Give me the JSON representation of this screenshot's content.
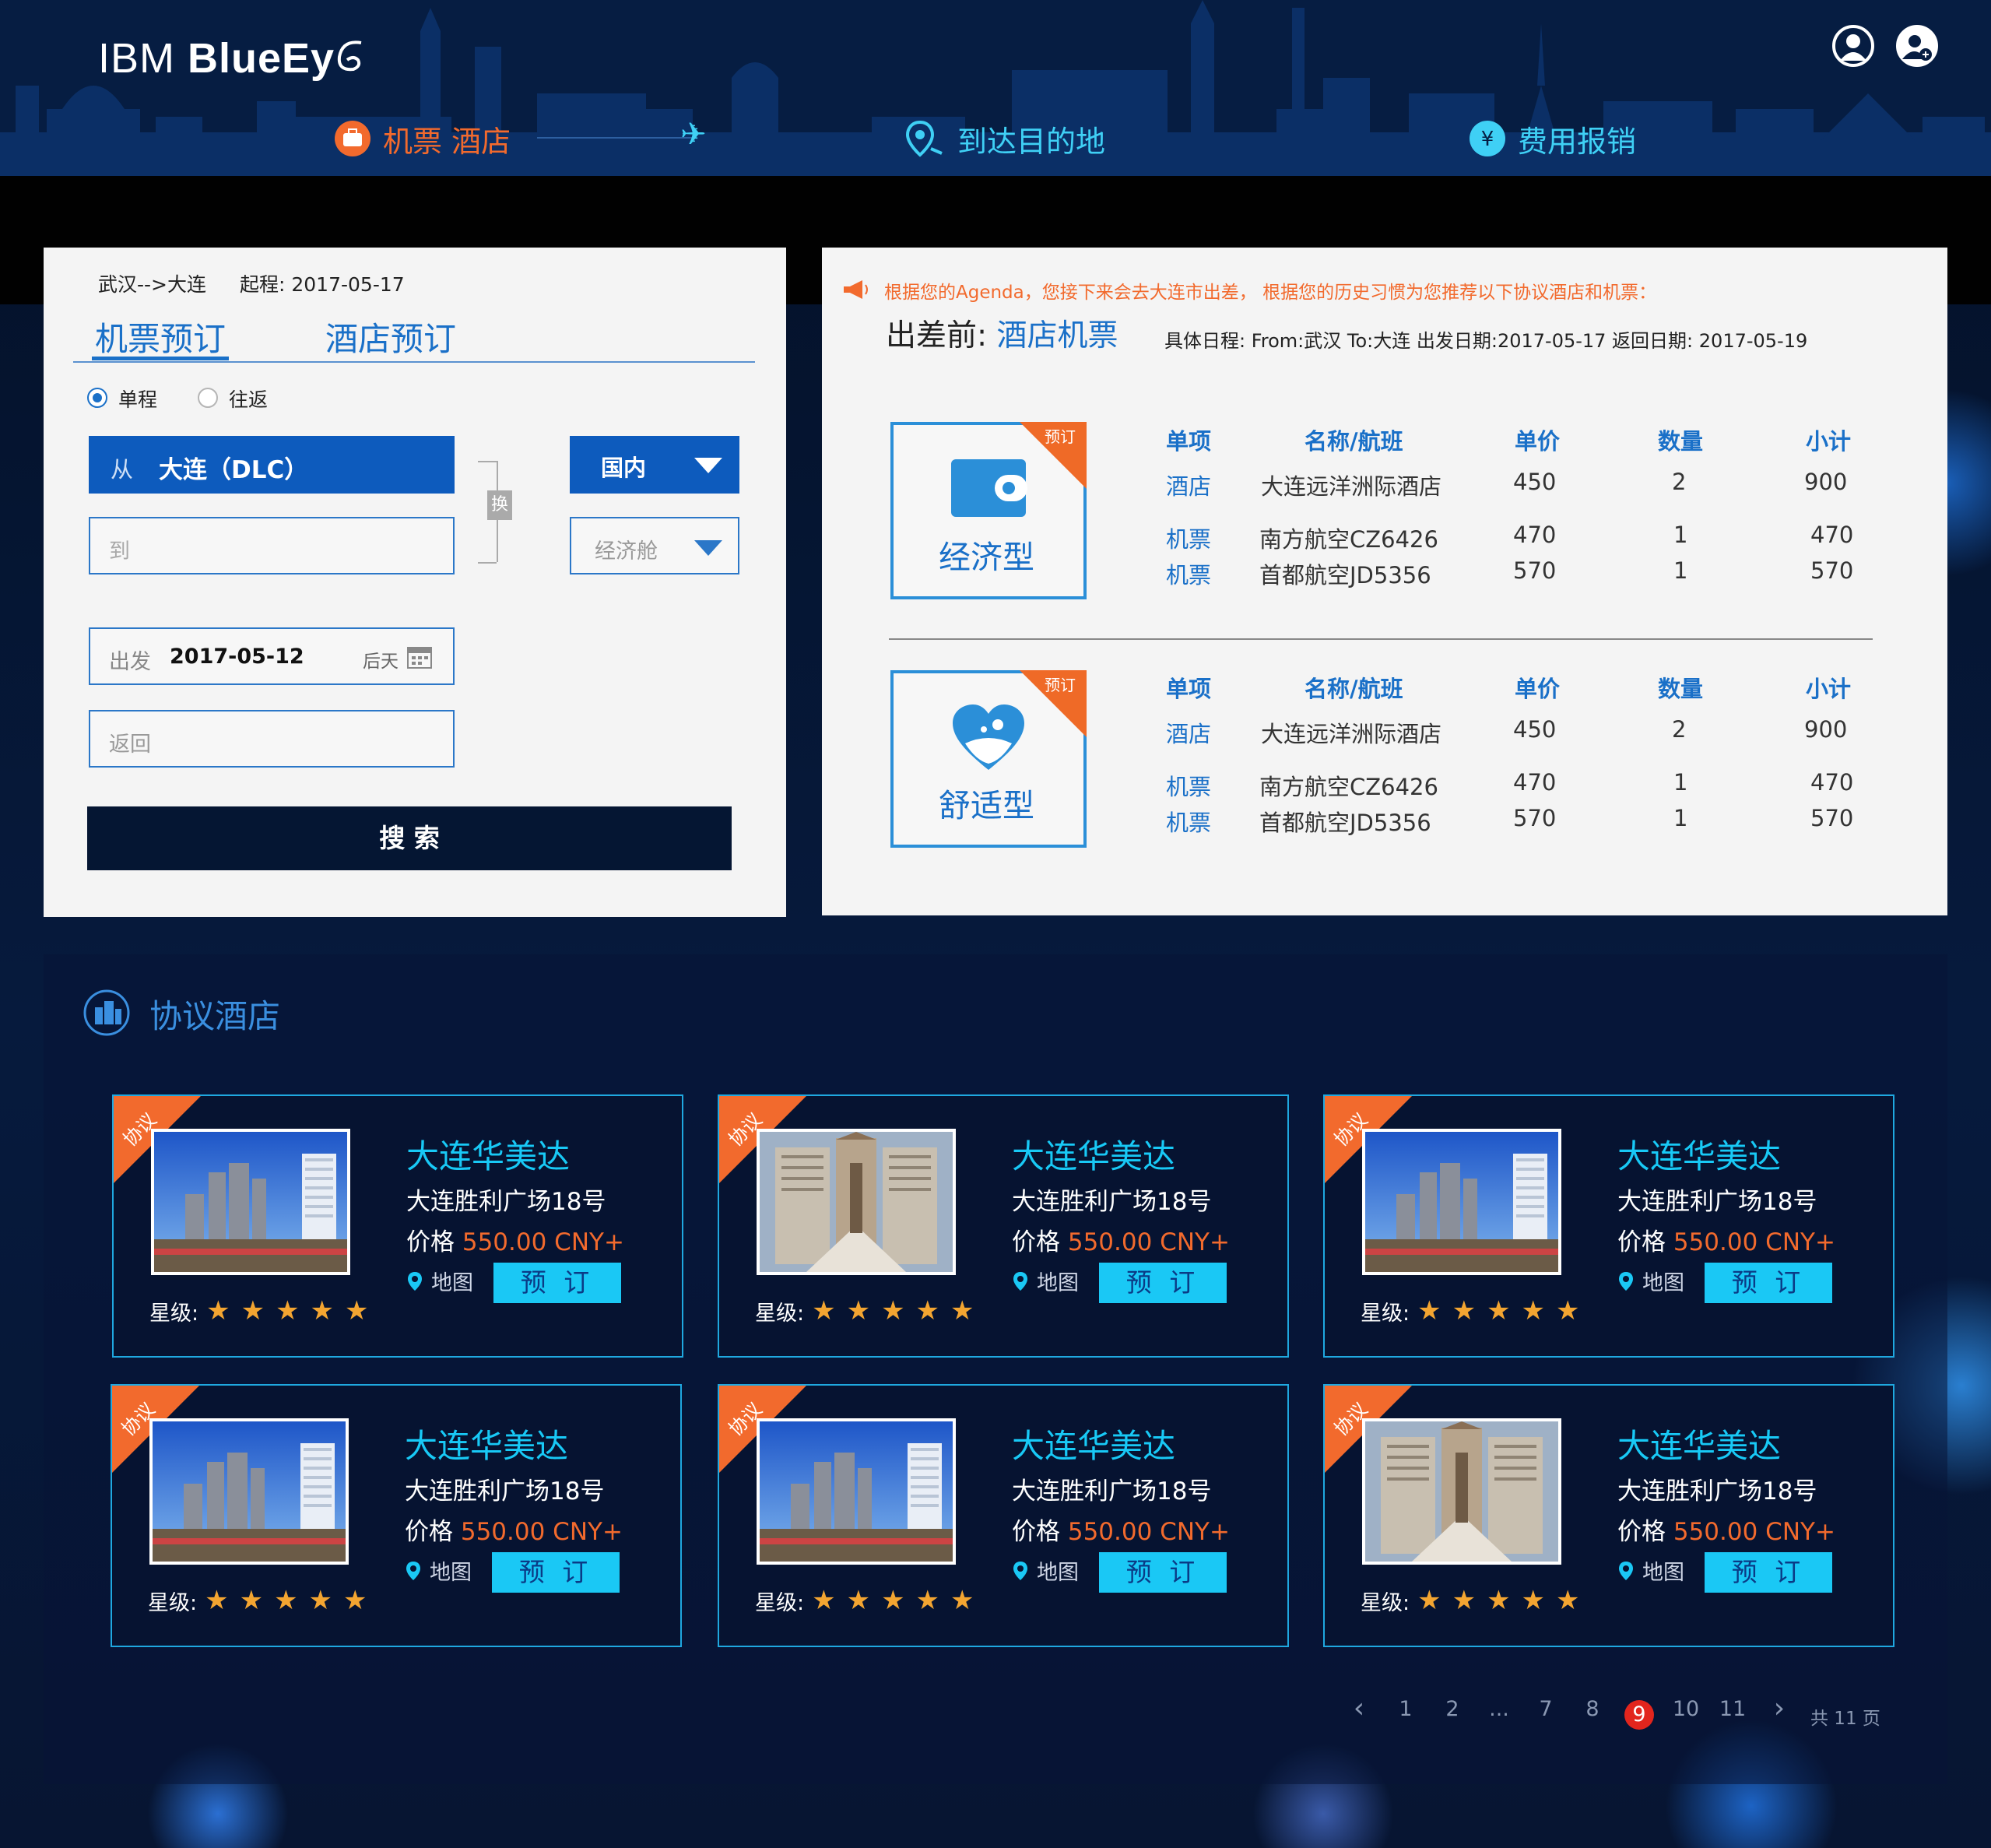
{
  "header": {
    "logo_light": "IBM ",
    "logo_bold": "BlueEy",
    "nav": [
      {
        "label": "机票 酒店",
        "color": "#f26a2d",
        "icon": "suitcase-icon"
      },
      {
        "label": "到达目的地",
        "color": "#3fd0f5",
        "icon": "location-icon"
      },
      {
        "label": "费用报销",
        "color": "#3fd0f5",
        "icon": "yen-icon"
      }
    ],
    "plane_glyph": "✈"
  },
  "booking": {
    "route": "武汉-->大连",
    "start_label": "起程: 2017-05-17",
    "tabs": [
      "机票预订",
      "酒店预订"
    ],
    "trip_types": [
      "单程",
      "往返"
    ],
    "from_prefix": "从",
    "from_value": "大连（DLC）",
    "swap_label": "换",
    "to_placeholder": "到",
    "region": "国内",
    "cabin": "经济舱",
    "depart_label": "出发",
    "depart_value": "2017-05-12",
    "depart_hint": "后天",
    "return_placeholder": "返回",
    "search_label": "搜 索"
  },
  "recommend": {
    "notice": "根据您的Agenda，您接下来会去大连市出差， 根据您的历史习惯为您推荐以下协议酒店和机票：",
    "title_prefix": "出差前: ",
    "title_main": "酒店机票",
    "schedule": "具体日程: From:武汉 To:大连 出发日期:2017-05-17 返回日期: 2017-05-19",
    "headers": [
      "单项",
      "名称/航班",
      "单价",
      "数量",
      "小计"
    ],
    "packages": [
      {
        "name": "经济型",
        "badge": "预订",
        "icon": "wallet-icon",
        "rows": [
          [
            "酒店",
            "大连远洋洲际酒店",
            "450",
            "2",
            "900"
          ],
          [
            "机票",
            "南方航空CZ6426",
            "470",
            "1",
            "470"
          ],
          [
            "机票",
            "首都航空JD5356",
            "570",
            "1",
            "570"
          ]
        ]
      },
      {
        "name": "舒适型",
        "badge": "预订",
        "icon": "heart-icon",
        "rows": [
          [
            "酒店",
            "大连远洋洲际酒店",
            "450",
            "2",
            "900"
          ],
          [
            "机票",
            "南方航空CZ6426",
            "470",
            "1",
            "470"
          ],
          [
            "机票",
            "首都航空JD5356",
            "570",
            "1",
            "570"
          ]
        ]
      }
    ]
  },
  "hotels": {
    "section_title": "协议酒店",
    "tag": "协议",
    "items": [
      {
        "name": "大连华美达",
        "address": "大连胜利广场18号",
        "price_label": "价格 ",
        "price": "550.00 CNY+",
        "map": "地图",
        "book": "预 订",
        "stars_label": "星级:",
        "stars": 5,
        "photo": "city"
      },
      {
        "name": "大连华美达",
        "address": "大连胜利广场18号",
        "price_label": "价格 ",
        "price": "550.00 CNY+",
        "map": "地图",
        "book": "预 订",
        "stars_label": "星级:",
        "stars": 5,
        "photo": "building"
      },
      {
        "name": "大连华美达",
        "address": "大连胜利广场18号",
        "price_label": "价格 ",
        "price": "550.00 CNY+",
        "map": "地图",
        "book": "预 订",
        "stars_label": "星级:",
        "stars": 5,
        "photo": "city"
      },
      {
        "name": "大连华美达",
        "address": "大连胜利广场18号",
        "price_label": "价格 ",
        "price": "550.00 CNY+",
        "map": "地图",
        "book": "预 订",
        "stars_label": "星级:",
        "stars": 5,
        "photo": "city"
      },
      {
        "name": "大连华美达",
        "address": "大连胜利广场18号",
        "price_label": "价格 ",
        "price": "550.00 CNY+",
        "map": "地图",
        "book": "预 订",
        "stars_label": "星级:",
        "stars": 5,
        "photo": "city"
      },
      {
        "name": "大连华美达",
        "address": "大连胜利广场18号",
        "price_label": "价格 ",
        "price": "550.00 CNY+",
        "map": "地图",
        "book": "预 订",
        "stars_label": "星级:",
        "stars": 5,
        "photo": "building"
      }
    ]
  },
  "pagination": {
    "prev": "‹",
    "pages": [
      "1",
      "2",
      "...",
      "7",
      "8",
      "9",
      "10",
      "11"
    ],
    "current": "9",
    "next": "›",
    "total": "共 11 页"
  }
}
